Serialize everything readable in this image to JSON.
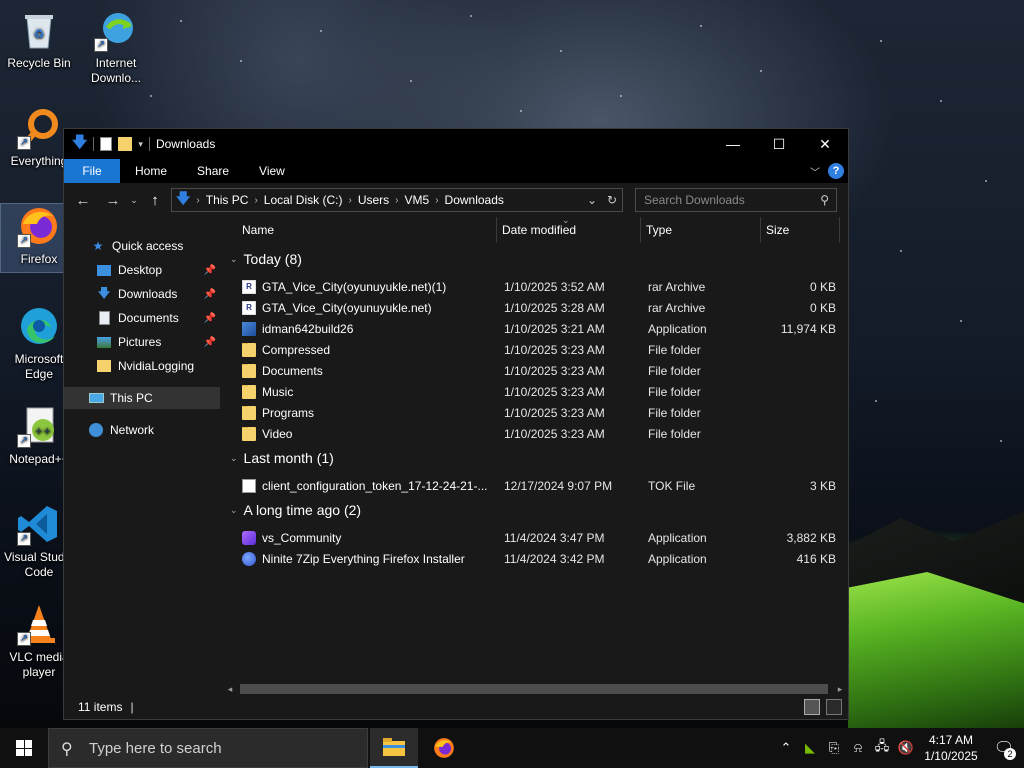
{
  "desktop": {
    "icons": [
      {
        "label": "Recycle Bin"
      },
      {
        "label": "Internet Downlo..."
      },
      {
        "label": "Everything"
      },
      {
        "label": "Firefox"
      },
      {
        "label": "Microsoft Edge"
      },
      {
        "label": "Notepad++"
      },
      {
        "label": "Visual Studio Code"
      },
      {
        "label": "VLC media player"
      }
    ]
  },
  "window": {
    "title": "Downloads",
    "controls": {
      "minimize": "—",
      "maximize": "☐",
      "close": "✕"
    },
    "ribbon": {
      "tabs": [
        "File",
        "Home",
        "Share",
        "View"
      ],
      "help": "?"
    },
    "address": {
      "segments": [
        "This PC",
        "Local Disk (C:)",
        "Users",
        "VM5",
        "Downloads"
      ]
    },
    "search": {
      "placeholder": "Search Downloads"
    },
    "nav": {
      "quick_access": "Quick access",
      "items": [
        "Desktop",
        "Downloads",
        "Documents",
        "Pictures",
        "NvidiaLogging"
      ],
      "this_pc": "This PC",
      "network": "Network"
    },
    "columns": {
      "name": "Name",
      "date": "Date modified",
      "type": "Type",
      "size": "Size"
    },
    "groups": [
      {
        "label": "Today (8)",
        "rows": [
          {
            "name": "GTA_Vice_City(oyunuyukle.net)(1)",
            "date": "1/10/2025 3:52 AM",
            "type": "rar Archive",
            "size": "0 KB",
            "icon": "rar-icon"
          },
          {
            "name": "GTA_Vice_City(oyunuyukle.net)",
            "date": "1/10/2025 3:28 AM",
            "type": "rar Archive",
            "size": "0 KB",
            "icon": "rar-icon"
          },
          {
            "name": "idman642build26",
            "date": "1/10/2025 3:21 AM",
            "type": "Application",
            "size": "11,974 KB",
            "icon": "app-icon"
          },
          {
            "name": "Compressed",
            "date": "1/10/2025 3:23 AM",
            "type": "File folder",
            "size": "",
            "icon": "folder-icon"
          },
          {
            "name": "Documents",
            "date": "1/10/2025 3:23 AM",
            "type": "File folder",
            "size": "",
            "icon": "folder-icon"
          },
          {
            "name": "Music",
            "date": "1/10/2025 3:23 AM",
            "type": "File folder",
            "size": "",
            "icon": "folder-icon"
          },
          {
            "name": "Programs",
            "date": "1/10/2025 3:23 AM",
            "type": "File folder",
            "size": "",
            "icon": "folder-icon"
          },
          {
            "name": "Video",
            "date": "1/10/2025 3:23 AM",
            "type": "File folder",
            "size": "",
            "icon": "folder-icon"
          }
        ]
      },
      {
        "label": "Last month (1)",
        "rows": [
          {
            "name": "client_configuration_token_17-12-24-21-...",
            "date": "12/17/2024 9:07 PM",
            "type": "TOK File",
            "size": "3 KB",
            "icon": "document-icon"
          }
        ]
      },
      {
        "label": "A long time ago (2)",
        "rows": [
          {
            "name": "vs_Community",
            "date": "11/4/2024 3:47 PM",
            "type": "Application",
            "size": "3,882 KB",
            "icon": "visual-studio-icon"
          },
          {
            "name": "Ninite 7Zip Everything Firefox Installer",
            "date": "11/4/2024 3:42 PM",
            "type": "Application",
            "size": "416 KB",
            "icon": "ninite-icon"
          }
        ]
      }
    ],
    "status": {
      "count": "11 items",
      "cursor": "|"
    }
  },
  "taskbar": {
    "search_placeholder": "Type here to search",
    "time": "4:17 AM",
    "date": "1/10/2025",
    "notifications": "2"
  },
  "colors": {
    "accent": "#1976d2",
    "folder": "#f5d26b",
    "window_bg": "#191919"
  }
}
